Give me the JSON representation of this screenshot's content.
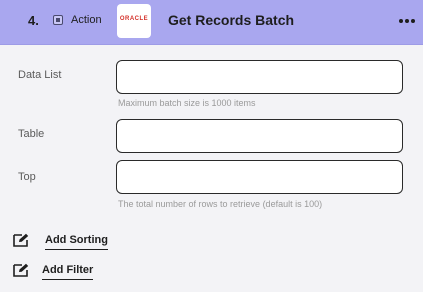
{
  "header": {
    "step_number": "4.",
    "action_label": "Action",
    "logo_text": "ORACLE",
    "title": "Get Records Batch",
    "more_icon": "more-dots-icon"
  },
  "fields": {
    "data_list": {
      "label": "Data List",
      "value": "",
      "hint": "Maximum batch size is 1000 items"
    },
    "table": {
      "label": "Table",
      "value": ""
    },
    "top": {
      "label": "Top",
      "value": "",
      "hint": "The total number of rows to retrieve (default is 100)"
    }
  },
  "actions": {
    "add_sorting": {
      "label": "Add Sorting",
      "icon": "edit-icon"
    },
    "add_filter": {
      "label": "Add Filter",
      "icon": "edit-icon"
    }
  },
  "colors": {
    "header_bg": "#a9a7ef",
    "body_bg": "#f3f3f6",
    "logo_red": "#d4312a"
  }
}
